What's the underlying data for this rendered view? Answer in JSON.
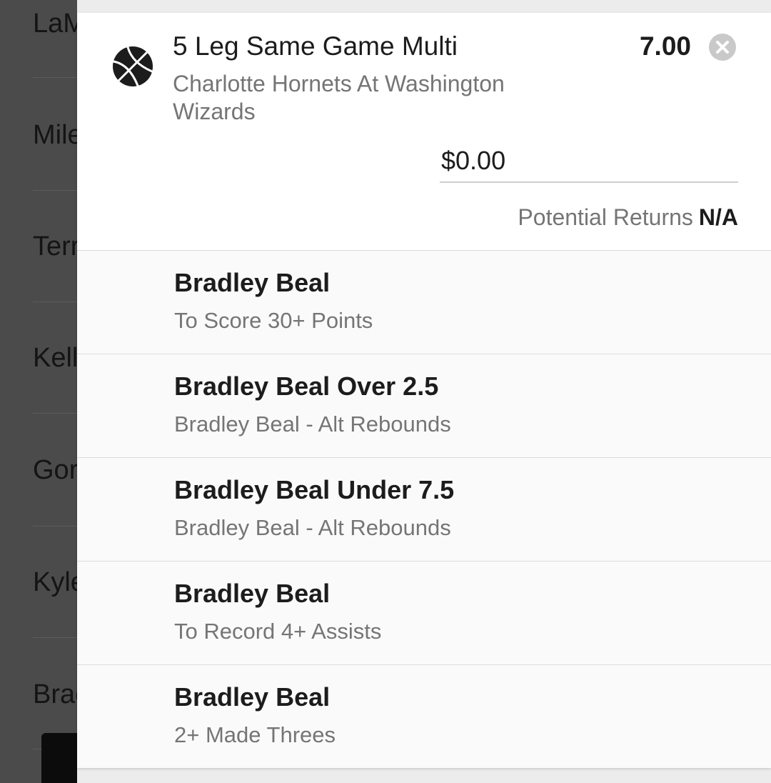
{
  "background_list": {
    "items": [
      "LaM",
      "Mile",
      "Terr",
      "Kell",
      "Gor",
      "Kyle",
      "Brac"
    ]
  },
  "bet_slip": {
    "title": "5 Leg Same Game Multi",
    "odds": "7.00",
    "event": "Charlotte Hornets At Washington Wizards",
    "stake": "$0.00",
    "potential_returns_label": "Potential Returns",
    "potential_returns_value": "N/A",
    "sport_icon": "basketball-icon",
    "close_icon": "close-icon",
    "legs": [
      {
        "selection": "Bradley Beal",
        "market": "To Score 30+ Points"
      },
      {
        "selection": "Bradley Beal Over 2.5",
        "market": "Bradley Beal - Alt Rebounds"
      },
      {
        "selection": "Bradley Beal Under 7.5",
        "market": "Bradley Beal - Alt Rebounds"
      },
      {
        "selection": "Bradley Beal",
        "market": "To Record 4+ Assists"
      },
      {
        "selection": "Bradley Beal",
        "market": "2+ Made Threes"
      }
    ]
  },
  "colors": {
    "overlay": "#4b4b4b",
    "card": "#ffffff",
    "leg_background": "#fafafa",
    "primary_text": "#1c1c1c",
    "secondary_text": "#757575"
  }
}
